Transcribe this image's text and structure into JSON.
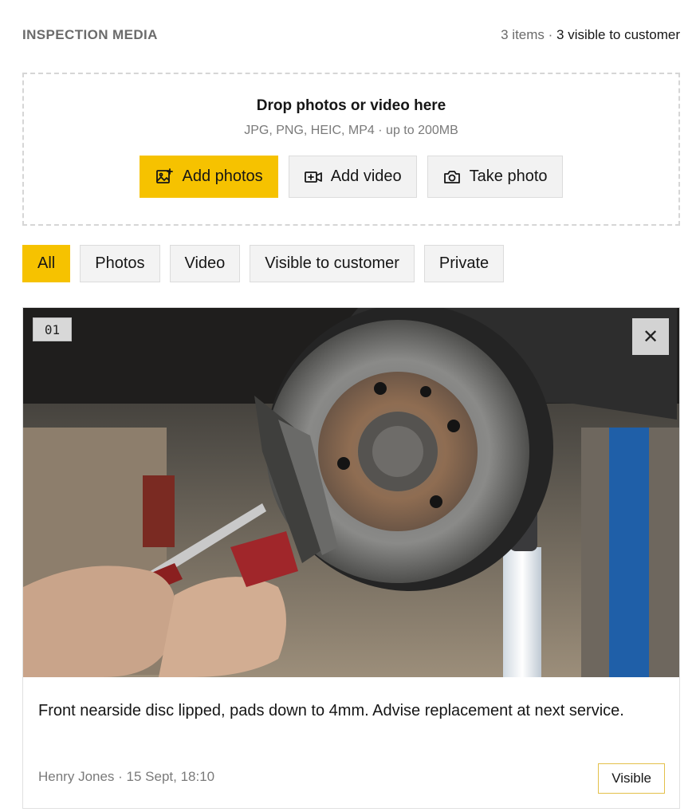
{
  "header": {
    "title": "INSPECTION MEDIA",
    "count_text": "3 items ·",
    "visible_text": "3 visible to customer"
  },
  "dropzone": {
    "title": "Drop photos or video here",
    "formats": "JPG, PNG, HEIC, MP4 · up to 200MB",
    "buttons": [
      {
        "label": "Add photos",
        "icon": "image-add-icon"
      },
      {
        "label": "Add video",
        "icon": "video-add-icon"
      },
      {
        "label": "Take photo",
        "icon": "camera-icon"
      }
    ]
  },
  "filters": {
    "active": "All",
    "items": [
      "All",
      "Photos",
      "Video",
      "Visible to customer",
      "Private"
    ]
  },
  "media_items": [
    {
      "index": "01",
      "caption": "Front nearside disc lipped, pads down to 4mm. Advise replacement at next service.",
      "author": "Henry Jones · 15 Sept, 18:10",
      "visibility": "Visible",
      "remove_icon": "close-icon"
    }
  ],
  "colors": {
    "accent": "#f6c200",
    "muted_text": "#7a7a7a",
    "chip_bg": "#f3f3f3"
  }
}
